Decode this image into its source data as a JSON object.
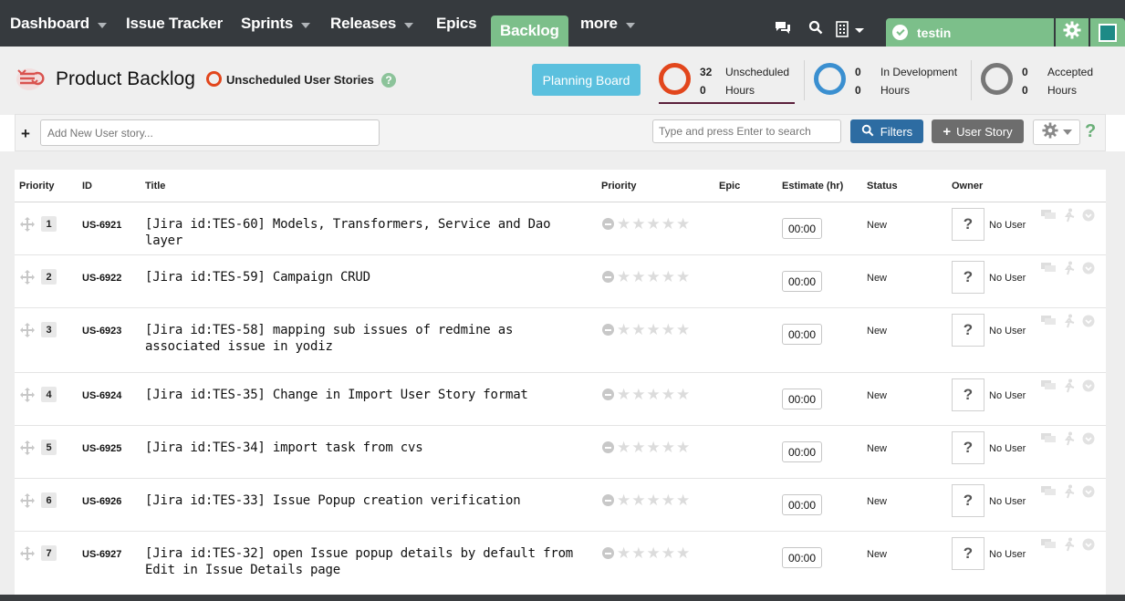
{
  "nav": {
    "items": [
      {
        "label": "Dashboard",
        "caret": true
      },
      {
        "label": "Issue Tracker",
        "caret": false
      },
      {
        "label": "Sprints",
        "caret": true
      },
      {
        "label": "Releases",
        "caret": true
      },
      {
        "label": "Epics",
        "caret": false
      },
      {
        "label": "Backlog",
        "caret": false,
        "active": true
      },
      {
        "label": "more",
        "caret": true
      }
    ],
    "user_name": "testin",
    "icons": [
      "chat-icon",
      "search-icon",
      "building-icon",
      "check-icon",
      "gear-icon",
      "square-icon"
    ]
  },
  "header": {
    "title": "Product Backlog",
    "filter_label": "Unscheduled User Stories",
    "help": "?",
    "planning_button": "Planning Board",
    "stats": [
      {
        "count": "32",
        "hours": "0",
        "label": "Unscheduled",
        "hours_label": "Hours",
        "color": "#e2461c"
      },
      {
        "count": "0",
        "hours": "0",
        "label": "In Development",
        "hours_label": "Hours",
        "color": "#3a8fd0"
      },
      {
        "count": "0",
        "hours": "0",
        "label": "Accepted",
        "hours_label": "Hours",
        "color": "#777777"
      }
    ]
  },
  "toolbar": {
    "add_placeholder": "Add New User story...",
    "search_placeholder": "Type and press Enter to search",
    "filters_label": "Filters",
    "user_story_label": "User Story",
    "help": "?"
  },
  "table": {
    "columns": [
      "Priority",
      "ID",
      "Title",
      "Priority",
      "Epic",
      "Estimate (hr)",
      "Status",
      "Owner"
    ],
    "rows": [
      {
        "priority": "1",
        "id": "US-6921",
        "title": "[Jira id:TES-60] Models, Transformers, Service and Dao layer",
        "estimate": "00:00",
        "status": "New",
        "owner": "No User",
        "avatar": "?"
      },
      {
        "priority": "2",
        "id": "US-6922",
        "title": "[Jira id:TES-59] Campaign CRUD",
        "estimate": "00:00",
        "status": "New",
        "owner": "No User",
        "avatar": "?"
      },
      {
        "priority": "3",
        "id": "US-6923",
        "title": "[Jira id:TES-58] mapping sub issues of redmine as associated issue in yodiz",
        "estimate": "00:00",
        "status": "New",
        "owner": "No User",
        "avatar": "?"
      },
      {
        "priority": "4",
        "id": "US-6924",
        "title": "[Jira id:TES-35] Change in Import User Story format",
        "estimate": "00:00",
        "status": "New",
        "owner": "No User",
        "avatar": "?"
      },
      {
        "priority": "5",
        "id": "US-6925",
        "title": "[Jira id:TES-34] import task from cvs",
        "estimate": "00:00",
        "status": "New",
        "owner": "No User",
        "avatar": "?"
      },
      {
        "priority": "6",
        "id": "US-6926",
        "title": "[Jira id:TES-33] Issue Popup creation verification",
        "estimate": "00:00",
        "status": "New",
        "owner": "No User",
        "avatar": "?"
      },
      {
        "priority": "7",
        "id": "US-6927",
        "title": "[Jira id:TES-32] open Issue popup details by default from Edit in Issue Details page",
        "estimate": "00:00",
        "status": "New",
        "owner": "No User",
        "avatar": "?"
      }
    ]
  }
}
